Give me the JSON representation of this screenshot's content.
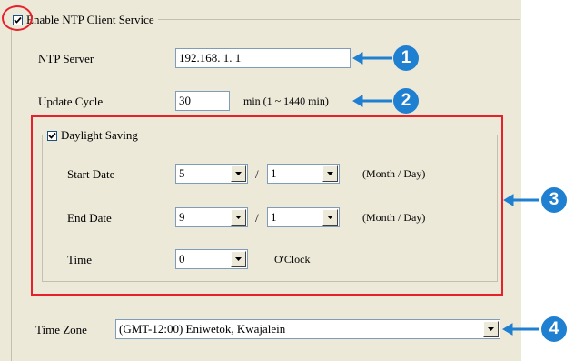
{
  "ntp": {
    "enable_label": "Enable NTP Client Service",
    "enable_checked": true,
    "server_label": "NTP Server",
    "server_value": "192.168.  1.  1",
    "update_label": "Update Cycle",
    "update_value": "30",
    "update_unit": "min (1 ~ 1440 min)"
  },
  "daylight": {
    "label": "Daylight Saving",
    "checked": true,
    "start_label": "Start Date",
    "start_month": "5",
    "start_day": "1",
    "end_label": "End Date",
    "end_month": "9",
    "end_day": "1",
    "separator": "/",
    "month_day_hint": "(Month / Day)",
    "time_label": "Time",
    "time_value": "0",
    "time_unit": "O'Clock"
  },
  "timezone": {
    "label": "Time Zone",
    "value": "(GMT-12:00) Eniwetok, Kwajalein"
  },
  "callouts": [
    "1",
    "2",
    "3",
    "4"
  ],
  "colors": {
    "highlight": "#e8202a",
    "callout": "#1f7fd0"
  }
}
